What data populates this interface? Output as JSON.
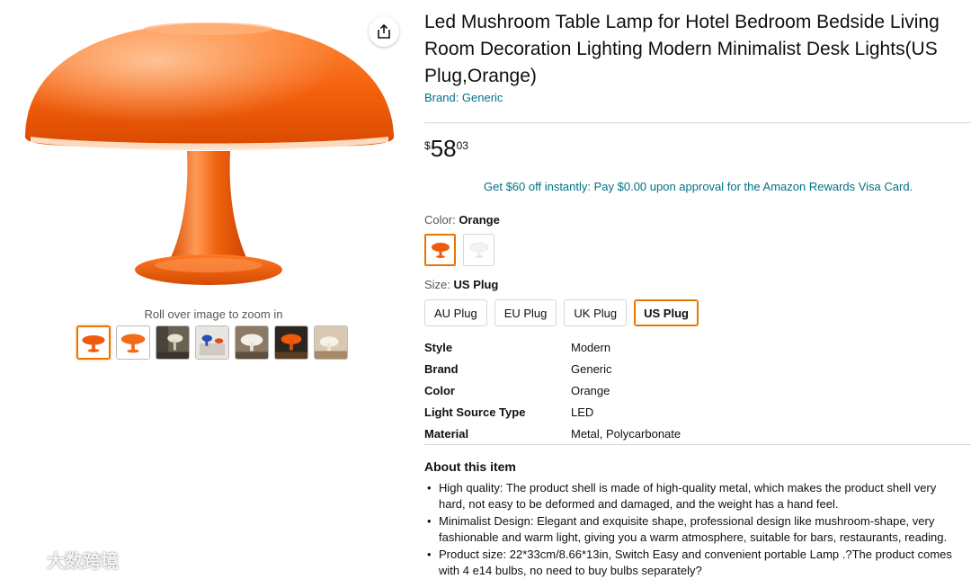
{
  "product": {
    "title": "Led Mushroom Table Lamp for Hotel Bedroom Bedside Living Room Decoration Lighting Modern Minimalist Desk Lights(US Plug,Orange)",
    "brand_link": "Brand: Generic"
  },
  "gallery": {
    "zoom_hint": "Roll over image to zoom in",
    "share_icon": "share-icon",
    "thumbnail_count": 7,
    "selected_thumbnail": 0
  },
  "price": {
    "symbol": "$",
    "whole": "58",
    "fraction": "03"
  },
  "promo": {
    "text": "Get $60 off instantly: Pay $0.00 upon approval for the Amazon Rewards Visa Card."
  },
  "color": {
    "label": "Color:",
    "selected": "Orange"
  },
  "size": {
    "label": "Size:",
    "selected": "US Plug",
    "options": [
      "AU Plug",
      "EU Plug",
      "UK Plug",
      "US Plug"
    ]
  },
  "specs": [
    {
      "key": "Style",
      "value": "Modern"
    },
    {
      "key": "Brand",
      "value": "Generic"
    },
    {
      "key": "Color",
      "value": "Orange"
    },
    {
      "key": "Light Source Type",
      "value": "LED"
    },
    {
      "key": "Material",
      "value": "Metal, Polycarbonate"
    }
  ],
  "about": {
    "title": "About this item",
    "bullets": [
      "High quality: The product shell is made of high-quality metal, which makes the product shell very hard, not easy to be deformed and damaged, and the weight has a hand feel.",
      "Minimalist Design: Elegant and exquisite shape, professional design like mushroom-shape, very fashionable and warm light, giving you a warm atmosphere, suitable for bars, restaurants, reading.",
      "Product size: 22*33cm/8.66*13in, Switch Easy and convenient portable Lamp .?The product comes with 4 e14 bulbs, no need to buy bulbs separately?"
    ]
  },
  "watermark": {
    "text": "大数跨境"
  },
  "colors": {
    "accent_orange": "#e77600",
    "lamp_orange": "#f05a0a",
    "link_teal": "#007185"
  }
}
